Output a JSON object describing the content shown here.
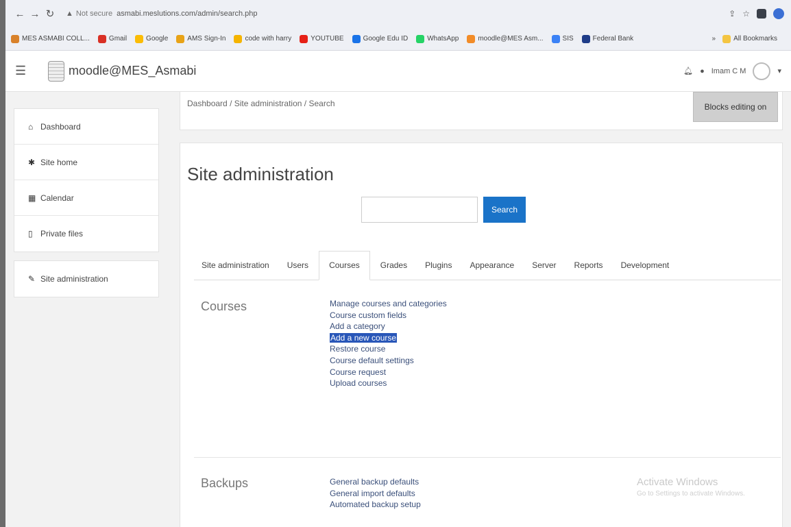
{
  "browser": {
    "address": {
      "security": "Not secure",
      "url": "asmabi.meslutions.com/admin/search.php"
    },
    "bookmarks": [
      {
        "label": "MES ASMABI COLL...",
        "color": "#d9822b"
      },
      {
        "label": "Gmail",
        "color": "#d93025"
      },
      {
        "label": "Google",
        "color": "#fbbc05"
      },
      {
        "label": "AMS Sign-In",
        "color": "#e8a317"
      },
      {
        "label": "code with harry",
        "color": "#f5b400"
      },
      {
        "label": "YOUTUBE",
        "color": "#e62117"
      },
      {
        "label": "Google Edu ID",
        "color": "#1a73e8"
      },
      {
        "label": "WhatsApp",
        "color": "#25d366"
      },
      {
        "label": "moodle@MES Asm...",
        "color": "#f28c28"
      },
      {
        "label": "SIS",
        "color": "#3b82f6"
      },
      {
        "label": "Federal Bank",
        "color": "#1f3c88"
      }
    ],
    "all_bookmarks": "All Bookmarks"
  },
  "navbar": {
    "brand": "moodle@MES_Asmabi",
    "user_name": "Imam C M"
  },
  "sidebar": {
    "group1": [
      {
        "label": "Dashboard",
        "icon": "⌂"
      },
      {
        "label": "Site home",
        "icon": "✱"
      },
      {
        "label": "Calendar",
        "icon": "▦"
      },
      {
        "label": "Private files",
        "icon": "▯"
      }
    ],
    "group2": [
      {
        "label": "Site administration",
        "icon": "✎"
      }
    ]
  },
  "breadcrumb": [
    "Dashboard",
    "Site administration",
    "Search"
  ],
  "blocks_button": "Blocks editing on",
  "main": {
    "title": "Site administration",
    "search_button": "Search",
    "tabs": [
      "Site administration",
      "Users",
      "Courses",
      "Grades",
      "Plugins",
      "Appearance",
      "Server",
      "Reports",
      "Development"
    ],
    "active_tab": "Courses",
    "sections": [
      {
        "title": "Courses",
        "links": [
          "Manage courses and categories",
          "Course custom fields",
          "Add a category",
          "Add a new course",
          "Restore course",
          "Course default settings",
          "Course request",
          "Upload courses"
        ],
        "highlighted": "Add a new course"
      },
      {
        "title": "Backups",
        "links": [
          "General backup defaults",
          "General import defaults",
          "Automated backup setup"
        ]
      }
    ]
  },
  "watermark": {
    "title": "Activate Windows",
    "subtitle": "Go to Settings to activate Windows."
  }
}
